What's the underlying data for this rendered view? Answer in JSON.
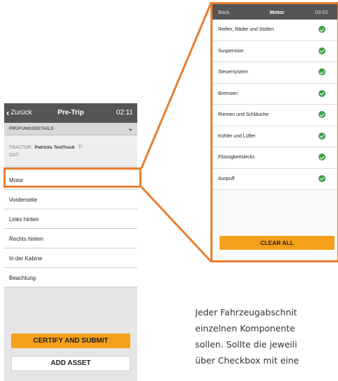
{
  "left_phone": {
    "back_label": "Zurück",
    "title": "Pre-Trip",
    "time": "02:11",
    "section_label": "PRÜFUNGSDETAILS",
    "tractor_label": "TRACTOR:",
    "tractor_value": "Patricks TestTruck",
    "dot_label": "DOT:",
    "items": [
      "Motor",
      "Vorderseite",
      "Links hinten",
      "Rechts hinten",
      "In der Kabine",
      "Beachtung"
    ],
    "certify_label": "CERTIFY AND SUBMIT",
    "add_asset_label": "ADD ASSET"
  },
  "right_phone": {
    "back_label": "Back",
    "title": "Motor",
    "time": "03:02",
    "items": [
      {
        "label": "Reifen, Räder und Stollen",
        "checked": true
      },
      {
        "label": "Suspension",
        "checked": true
      },
      {
        "label": "Steuersystem",
        "checked": true
      },
      {
        "label": "Bremsen",
        "checked": true
      },
      {
        "label": "Riemen und Schläuche",
        "checked": true
      },
      {
        "label": "Kühler und Lüfter",
        "checked": true
      },
      {
        "label": "Flüssigkeitslecks",
        "checked": true
      },
      {
        "label": "Auspuff",
        "checked": true
      }
    ],
    "clear_all_label": "CLEAR ALL"
  },
  "caption_lines": [
    "Jeder Fahrzeugabschnit",
    "einzelnen Komponente",
    "sollen. Sollte die jeweili",
    "über Checkbox mit eine"
  ],
  "colors": {
    "highlight": "#e87e2e",
    "header_bg": "#555555",
    "button_orange": "#f5a01a",
    "check_green": "#3aa047"
  },
  "icons": {
    "back": "chevron-left-icon",
    "collapse": "chevron-down-icon",
    "flag": "flag-icon",
    "check": "check-circle-icon"
  }
}
